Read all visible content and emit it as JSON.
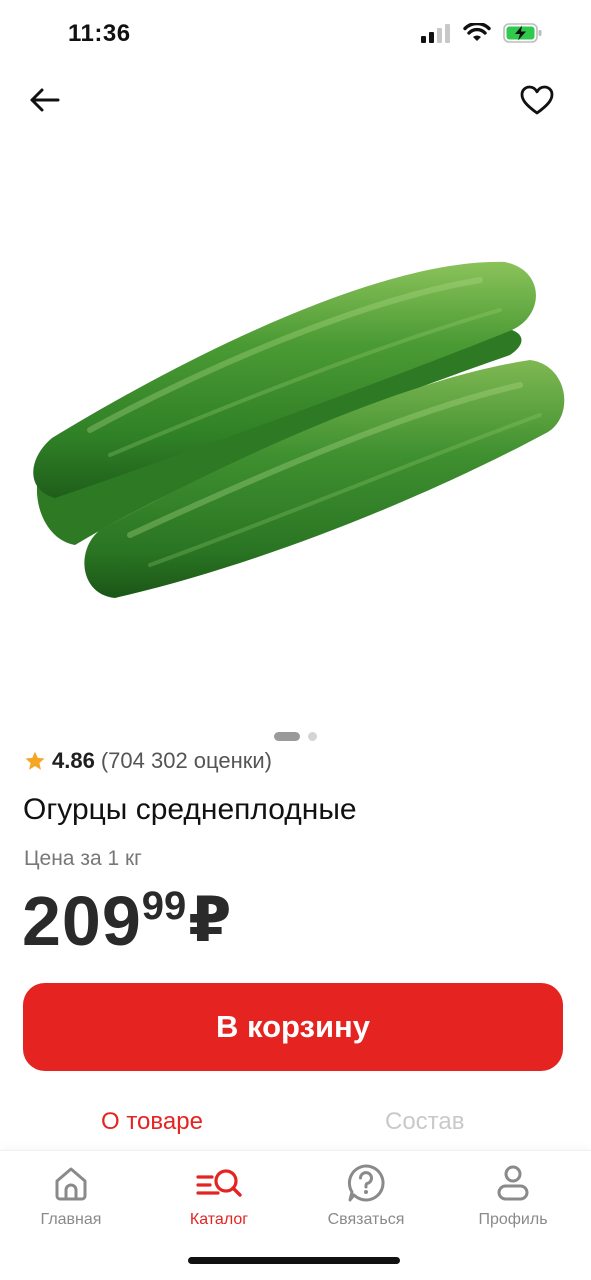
{
  "status_bar": {
    "time": "11:36"
  },
  "product": {
    "image_alt": "cucumbers",
    "rating": "4.86",
    "rating_count": "(704 302 оценки)",
    "title": "Огурцы среднеплодные",
    "price_unit": "Цена за 1 кг",
    "price_rub": "209",
    "price_kop": "99",
    "currency": "₽",
    "carousel_index": 1,
    "carousel_total": 2
  },
  "actions": {
    "add_to_cart": "В корзину"
  },
  "tabs": [
    {
      "label": "О товаре",
      "active": true
    },
    {
      "label": "Состав",
      "active": false
    }
  ],
  "bottom_nav": [
    {
      "label": "Главная",
      "icon": "home-icon",
      "active": false
    },
    {
      "label": "Каталог",
      "icon": "catalog-search-icon",
      "active": true
    },
    {
      "label": "Связаться",
      "icon": "help-icon",
      "active": false
    },
    {
      "label": "Профиль",
      "icon": "profile-icon",
      "active": false
    }
  ],
  "colors": {
    "accent": "#e52421",
    "icon_gray": "#8a8a8a"
  }
}
